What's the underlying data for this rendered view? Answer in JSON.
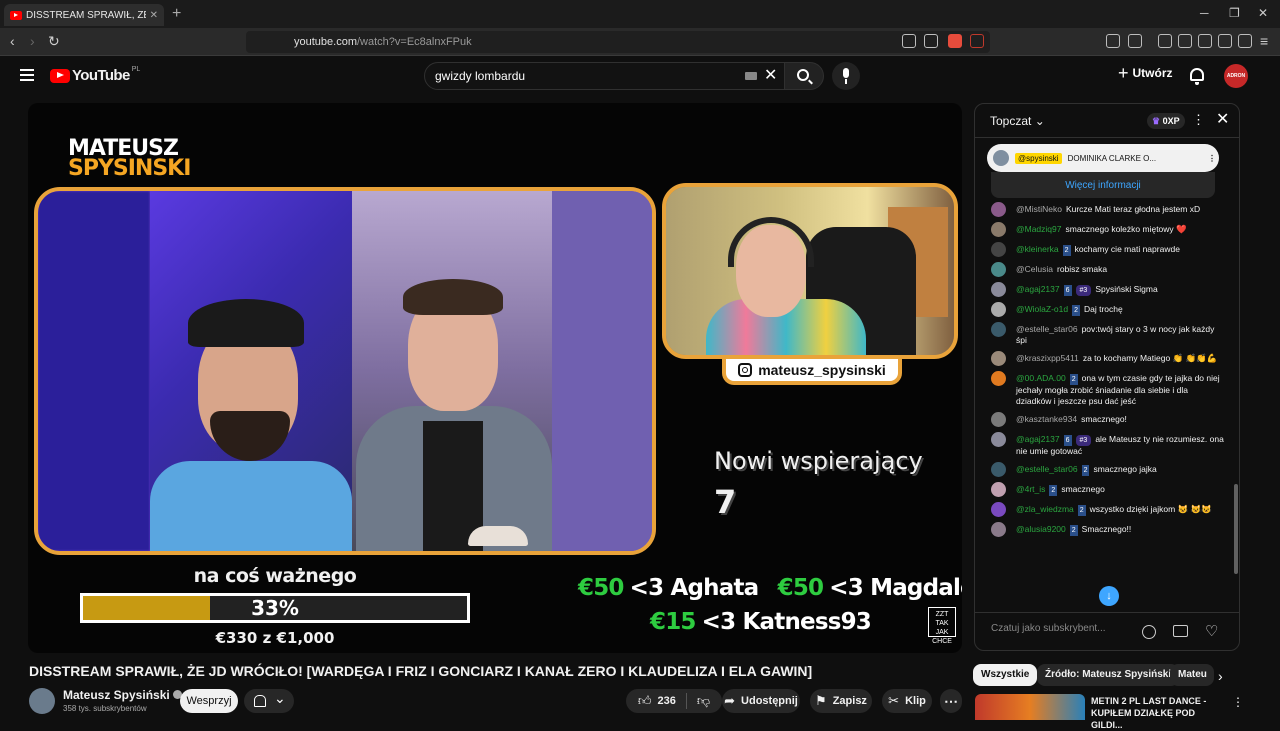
{
  "browser": {
    "tab_title": "DISSTREAM SPRAWIŁ, ŻE JD W",
    "url_host": "youtube.com",
    "url_path": "/watch?v=Ec8alnxFPuk"
  },
  "header": {
    "logo_text": "YouTube",
    "country_code": "PL",
    "search_value": "gwizdy lombardu",
    "create_label": "Utwórz",
    "avatar_text": "ADRON"
  },
  "overlay": {
    "brand_line1": "MATEUSZ",
    "brand_line2": "SPYSINSKI",
    "instagram": "mateusz_spysinski",
    "supporters_title": "Nowi wspierający",
    "supporters_count": "7",
    "goal_label": "na coś ważnego",
    "goal_percent_text": "33%",
    "goal_fraction": 0.33,
    "goal_amount": "€330 z €1,000",
    "donations_row1": [
      {
        "amount": "€50",
        "text": "<3 Aghata"
      },
      {
        "amount": "€50",
        "text": "<3 Magdalena"
      }
    ],
    "donations_row2": [
      {
        "amount": "€15",
        "text": "<3 Katness93"
      }
    ],
    "corner_logo": "ZZT TAK JAK CHCE"
  },
  "video": {
    "title": "DISSTREAM SPRAWIŁ, ŻE JD WRÓCIŁO! [WARDĘGA I FRIZ I GONCIARZ I KANAŁ ZERO I KLAUDELIZA I ELA GAWIN]",
    "channel_name": "Mateusz Spysiński",
    "subscribers": "358 tys. subskrybentów",
    "support_label": "Wesprzyj",
    "likes": "236",
    "share_label": "Udostępnij",
    "save_label": "Zapisz",
    "clip_label": "Klip"
  },
  "chat": {
    "mode": "Topczat",
    "xp": "0XP",
    "pinned_user": "@spysinski",
    "pinned_text": "DOMINIKA CLARKE O...",
    "more_info": "Więcej informacji",
    "input_placeholder": "Czatuj jako subskrybent...",
    "messages": [
      {
        "user": "@MistiNeko",
        "member": false,
        "badge": "",
        "rank": "",
        "text": "Kurcze Mati teraz głodna jestem xD",
        "color": "#8a5a8a"
      },
      {
        "user": "@Madziq97",
        "member": true,
        "badge": "",
        "rank": "",
        "text": "smacznego koleżko miętowy ❤️",
        "color": "#8a7a6a"
      },
      {
        "user": "@kleinerka",
        "member": true,
        "badge": "2",
        "rank": "",
        "text": "kochamy cie mati naprawde",
        "color": "#444"
      },
      {
        "user": "@Celusia",
        "member": false,
        "badge": "",
        "rank": "",
        "text": "robisz smaka",
        "color": "#4a8a8a"
      },
      {
        "user": "@agaj2137",
        "member": true,
        "badge": "6",
        "rank": "#3",
        "text": "Spysiński Sigma",
        "color": "#8a8a9a"
      },
      {
        "user": "@WiolaZ-o1d",
        "member": true,
        "badge": "2",
        "rank": "",
        "text": "Daj trochę",
        "color": "#aaa"
      },
      {
        "user": "@estelle_star06",
        "member": false,
        "badge": "",
        "rank": "",
        "text": "pov:twój stary o 3 w nocy jak każdy śpi",
        "color": "#3a5a6a"
      },
      {
        "user": "@kraszixpp5411",
        "member": false,
        "badge": "",
        "rank": "",
        "text": "za to kochamy Matiego 👏 👏👏💪",
        "color": "#9a8a7a"
      },
      {
        "user": "@00.ADA.00",
        "member": true,
        "badge": "2",
        "rank": "",
        "text": "ona w tym czasie gdy te jajka do niej jechały mogła zrobić śniadanie dla siebie i dla dziadków i jeszcze psu dać jeść",
        "color": "#e07a20"
      },
      {
        "user": "@kasztanke934",
        "member": false,
        "badge": "",
        "rank": "",
        "text": "smacznego!",
        "color": "#7a7a7a"
      },
      {
        "user": "@agaj2137",
        "member": true,
        "badge": "6",
        "rank": "#3",
        "text": "ale Mateusz ty nie rozumiesz. ona nie umie gotować",
        "color": "#8a8a9a"
      },
      {
        "user": "@estelle_star06",
        "member": true,
        "badge": "2",
        "rank": "",
        "text": "smacznego jajka",
        "color": "#3a5a6a"
      },
      {
        "user": "@4rt_is",
        "member": true,
        "badge": "2",
        "rank": "",
        "text": "smacznego",
        "color": "#c0a0b0"
      },
      {
        "user": "@zla_wiedzma",
        "member": true,
        "badge": "2",
        "rank": "",
        "text": "wszystko dzięki jajkom 😺 😺😺",
        "color": "#7a4ac0"
      },
      {
        "user": "@alusia9200",
        "member": true,
        "badge": "2",
        "rank": "",
        "text": "Smacznego!!",
        "color": "#8a7a8a"
      }
    ]
  },
  "chips": [
    "Wszystkie",
    "Źródło: Mateusz Spysiński",
    "Mateu"
  ],
  "recommendation": {
    "title": "METIN 2 PL LAST DANCE - KUPIŁEM DZIAŁKĘ POD GILDI..."
  },
  "colors": {
    "accent_orange": "#e9a33a",
    "goal_fill": "#c79a12",
    "donation_green": "#2ecc40",
    "link_blue": "#3ea6ff",
    "youtube_red": "#ff0000"
  }
}
